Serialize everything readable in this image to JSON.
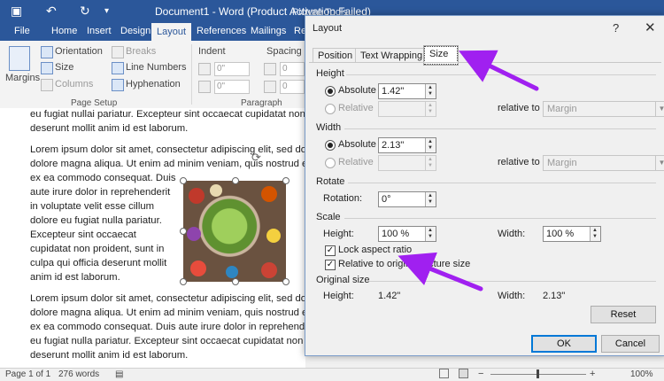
{
  "word": {
    "title": "Document1 - Word (Product Activation Failed)",
    "picture_tools": "Picture Tools",
    "tabs": [
      "File",
      "Home",
      "Insert",
      "Design",
      "Layout",
      "References",
      "Mailings",
      "Re"
    ],
    "active_tab": "Layout",
    "ribbon": {
      "margins": "Margins",
      "orientation": "Orientation",
      "size": "Size",
      "columns": "Columns",
      "breaks": "Breaks",
      "line_numbers": "Line Numbers",
      "hyphenation": "Hyphenation",
      "page_setup": "Page Setup",
      "indent": "Indent",
      "spacing": "Spacing",
      "indent_left": "0\"",
      "indent_right": "0\"",
      "spacing_before": "0",
      "spacing_after": "0",
      "paragraph": "Paragraph"
    },
    "doc_lines": [
      "eu fugiat nullai pariatur. Excepteur sint occaecat cupidatat non",
      "deserunt mollit anim id est laborum.",
      "Lorem ipsum dolor sit amet, consectetur adipiscing elit, sed do",
      "dolore magna aliqua. Ut enim ad minim veniam, quis nostrud e",
      "ex ea commodo consequat. Duis",
      "aute irure dolor in reprehenderit",
      "in voluptate velit esse cillum",
      "dolore eu fugiat nulla pariatur.",
      "Excepteur sint occaecat",
      "cupidatat non proident, sunt in",
      "culpa qui officia deserunt mollit",
      "anim id est laborum.",
      "Lorem ipsum dolor sit amet, consectetur adipiscing elit, sed do",
      "dolore magna aliqua. Ut enim ad minim veniam, quis nostrud e",
      "ex ea commodo consequat. Duis aute irure dolor in reprehende",
      "eu fugiat nulla pariatur. Excepteur sint occaecat cupidatat non",
      "deserunt mollit anim id est laborum."
    ],
    "status": {
      "page": "Page 1 of 1",
      "words": "276 words",
      "zoom": "100%"
    }
  },
  "dialog": {
    "title": "Layout",
    "help": "?",
    "close": "✕",
    "tabs": [
      "Position",
      "Text Wrapping",
      "Size"
    ],
    "active_tab": "Size",
    "height": {
      "section": "Height",
      "absolute_label": "Absolute",
      "absolute_value": "1.42\"",
      "relative_label": "Relative",
      "relative_to_label": "relative to",
      "relative_to_value": "Margin"
    },
    "width": {
      "section": "Width",
      "absolute_label": "Absolute",
      "absolute_value": "2.13\"",
      "relative_label": "Relative",
      "relative_to_label": "relative to",
      "relative_to_value": "Margin"
    },
    "rotate": {
      "section": "Rotate",
      "rotation_label": "Rotation:",
      "rotation_value": "0°"
    },
    "scale": {
      "section": "Scale",
      "height_label": "Height:",
      "height_value": "100 %",
      "width_label": "Width:",
      "width_value": "100 %",
      "lock_aspect": "Lock aspect ratio",
      "lock_aspect_checked": true,
      "relative_original": "Relative to original picture size",
      "relative_original_checked": true
    },
    "original": {
      "section": "Original size",
      "height_label": "Height:",
      "height_value": "1.42\"",
      "width_label": "Width:",
      "width_value": "2.13\""
    },
    "reset": "Reset",
    "ok": "OK",
    "cancel": "Cancel"
  },
  "colors": {
    "word_blue": "#2b579a",
    "annotation_arrow": "#a020f0"
  }
}
